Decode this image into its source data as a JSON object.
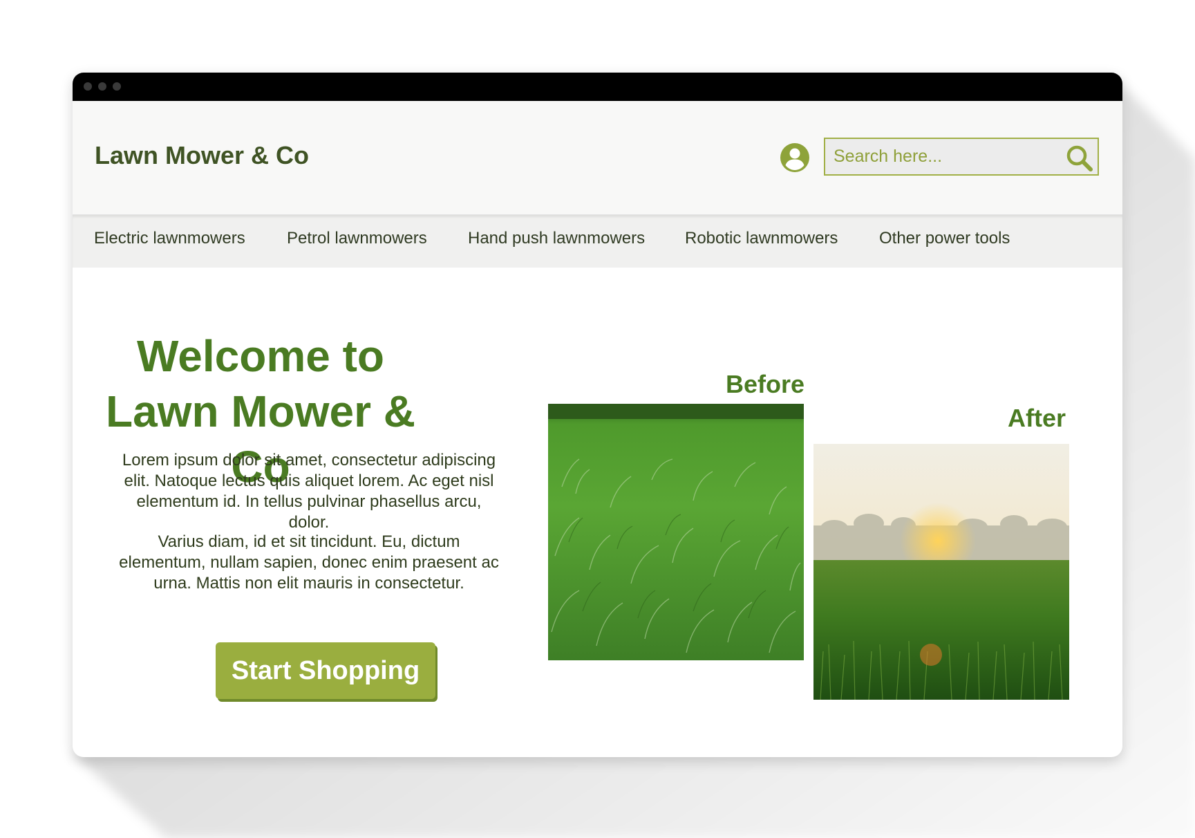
{
  "app": {
    "brand": "Lawn Mower & Co",
    "accent_color": "#4a7b22",
    "button_color": "#9aae3f"
  },
  "header": {
    "account_icon": "user-circle-icon",
    "search": {
      "placeholder": "Search here...",
      "value": "",
      "icon": "search-icon"
    }
  },
  "nav": {
    "items": [
      {
        "label": "Electric lawnmowers"
      },
      {
        "label": "Petrol lawnmowers"
      },
      {
        "label": "Hand push lawnmowers"
      },
      {
        "label": "Robotic lawnmowers"
      },
      {
        "label": "Other power tools"
      }
    ]
  },
  "hero": {
    "title_line1": "Welcome to",
    "title_line2": "Lawn Mower & Co",
    "paragraph1": "Lorem ipsum dolor sit amet, consectetur adipiscing elit. Natoque lectus quis aliquet lorem. Ac eget nisl elementum id. In tellus pulvinar phasellus arcu, dolor.",
    "paragraph2": "Varius diam, id et sit tincidunt. Eu, dictum elementum, nullam sapien, donec enim praesent ac urna. Mattis non elit mauris in consectetur.",
    "cta_label": "Start Shopping"
  },
  "gallery": {
    "before_label": "Before",
    "after_label": "After"
  }
}
